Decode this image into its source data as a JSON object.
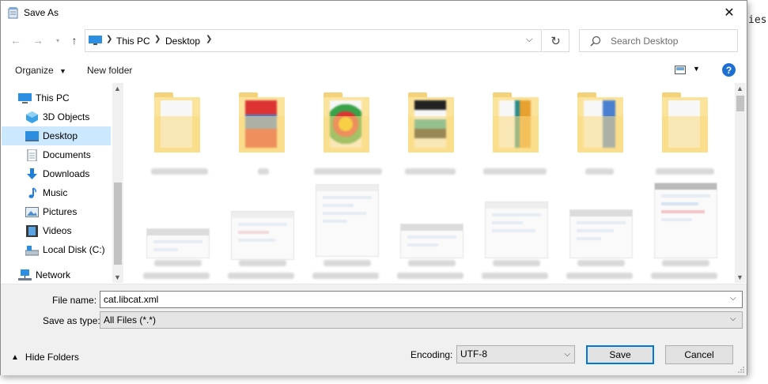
{
  "background": {
    "text": "ies."
  },
  "window": {
    "title": "Save As"
  },
  "address": {
    "crumbs": [
      "This PC",
      "Desktop"
    ],
    "search_placeholder": "Search Desktop"
  },
  "toolbar": {
    "organize": "Organize",
    "new_folder": "New folder",
    "help": "?"
  },
  "nav": {
    "items": [
      {
        "label": "This PC",
        "icon": "pc-icon"
      },
      {
        "label": "3D Objects",
        "icon": "cube-icon"
      },
      {
        "label": "Desktop",
        "icon": "desktop-icon",
        "selected": true
      },
      {
        "label": "Documents",
        "icon": "document-icon"
      },
      {
        "label": "Downloads",
        "icon": "download-icon"
      },
      {
        "label": "Music",
        "icon": "music-icon"
      },
      {
        "label": "Pictures",
        "icon": "pictures-icon"
      },
      {
        "label": "Videos",
        "icon": "video-icon"
      },
      {
        "label": "Local Disk (C:)",
        "icon": "disk-icon"
      },
      {
        "label": "Network",
        "icon": "network-icon"
      }
    ]
  },
  "form": {
    "file_name_label": "File name:",
    "file_name_value": "cat.libcat.xml",
    "save_type_label": "Save as type:",
    "save_type_value": "All Files  (*.*)",
    "encoding_label": "Encoding:",
    "encoding_value": "UTF-8"
  },
  "footer": {
    "hide_folders": "Hide Folders",
    "save": "Save",
    "cancel": "Cancel"
  },
  "colors": {
    "selection": "#cce8ff",
    "accent": "#0078d7",
    "folder": "#fbe39c"
  }
}
